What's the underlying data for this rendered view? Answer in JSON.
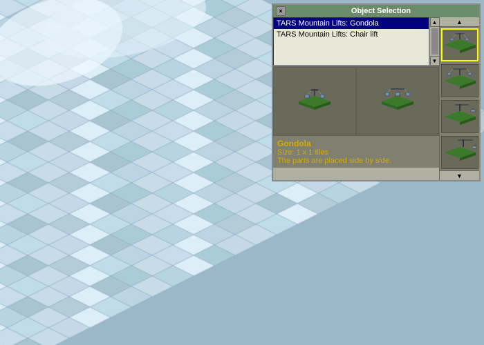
{
  "panel": {
    "title": "Object Selection",
    "close_button": "×",
    "items": [
      {
        "label": "TARS Mountain Lifts: Gondola",
        "selected": true
      },
      {
        "label": "TARS Mountain Lifts: Chair lift",
        "selected": false
      }
    ],
    "info": {
      "name": "Gondola",
      "size_label": "Size:",
      "size_value": "1 x 1 tiles",
      "desc": "The parts are placed side by side."
    }
  },
  "scrollbar": {
    "up_arrow": "▲",
    "down_arrow": "▼"
  },
  "thumb_scroll": {
    "up": "▲",
    "down": "▼"
  }
}
